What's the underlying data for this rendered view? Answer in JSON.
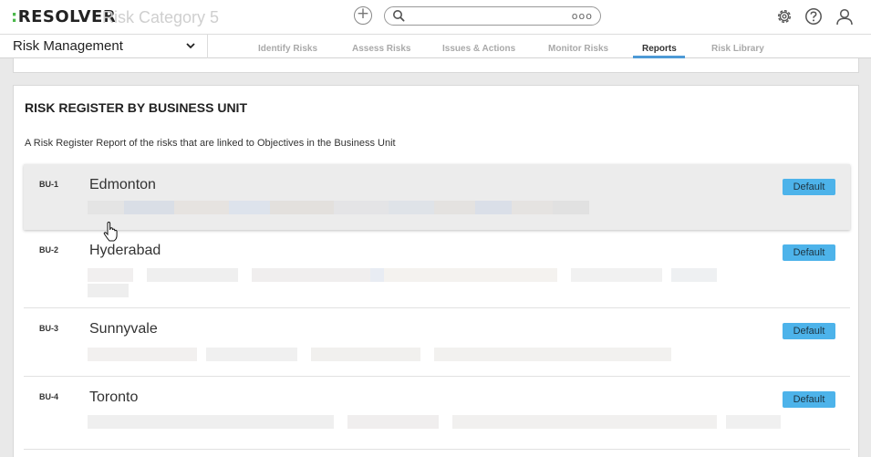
{
  "header": {
    "logo_mark": ":",
    "logo_text": "RESOLVER",
    "ghost_title": "Risk Category 5",
    "add_symbol": "+",
    "search_more": "ooo",
    "icons": [
      "plus-circle-icon",
      "search-icon",
      "more-icon",
      "gear-icon",
      "help-icon",
      "user-icon"
    ]
  },
  "nav": {
    "app_name": "Risk Management",
    "tabs": [
      {
        "label": "Identify Risks",
        "active": false
      },
      {
        "label": "Assess Risks",
        "active": false
      },
      {
        "label": "Issues & Actions",
        "active": false
      },
      {
        "label": "Monitor Risks",
        "active": false
      },
      {
        "label": "Reports",
        "active": true
      },
      {
        "label": "Risk Library",
        "active": false
      }
    ]
  },
  "report": {
    "title": "RISK REGISTER BY BUSINESS UNIT",
    "description": "A Risk Register Report of the risks that are linked to Objectives in the Business Unit",
    "rows": [
      {
        "code": "BU-1",
        "name": "Edmonton",
        "badge": "Default"
      },
      {
        "code": "BU-2",
        "name": "Hyderabad",
        "badge": "Default"
      },
      {
        "code": "BU-3",
        "name": "Sunnyvale",
        "badge": "Default"
      },
      {
        "code": "BU-4",
        "name": "Toronto",
        "badge": "Default"
      }
    ]
  },
  "colors": {
    "accent_tab": "#4d9ad6",
    "badge": "#4db3ea",
    "logo_dot": "#4cb84c"
  }
}
